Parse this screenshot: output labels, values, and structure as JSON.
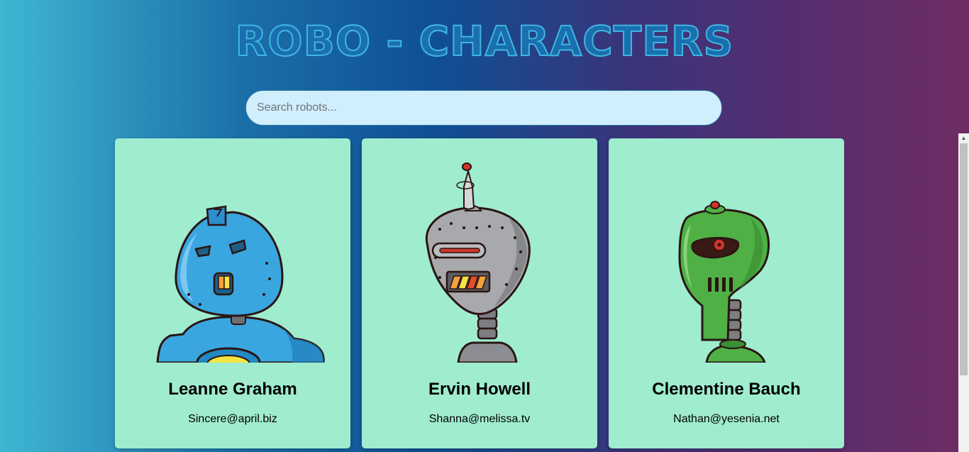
{
  "app": {
    "title": "ROBO - CHARACTERS"
  },
  "search": {
    "placeholder": "Search robots...",
    "value": ""
  },
  "robots": [
    {
      "name": "Leanne Graham",
      "email": "Sincere@april.biz",
      "color": "#3aa6e0"
    },
    {
      "name": "Ervin Howell",
      "email": "Shanna@melissa.tv",
      "color": "#a7a9ad"
    },
    {
      "name": "Clementine Bauch",
      "email": "Nathan@yesenia.net",
      "color": "#4fb045"
    }
  ],
  "colors": {
    "card_background": "#9feccf",
    "search_background": "#d0eefb",
    "title_fill": "#1a6fae",
    "title_stroke": "#3fb6e0"
  }
}
